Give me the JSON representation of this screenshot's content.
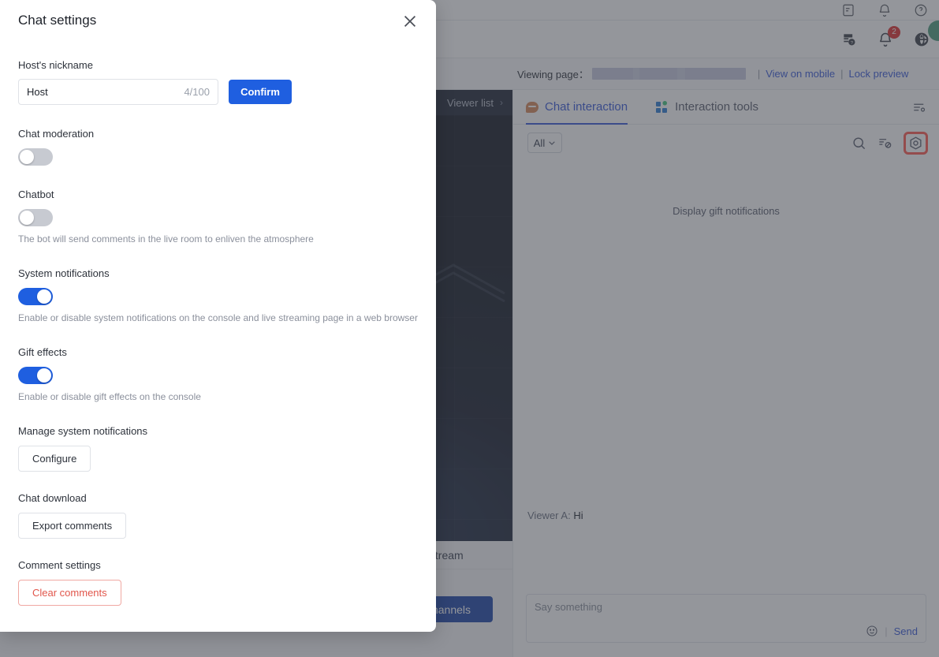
{
  "app": {
    "header": {
      "icons": [
        "doc-help-icon",
        "bell-icon",
        "globe-icon",
        "avatar"
      ],
      "notification_count": "2"
    },
    "viewing_bar": {
      "label": "Viewing page：",
      "url_redacted": "",
      "separator": "|",
      "view_on_mobile": "View on mobile",
      "lock_preview": "Lock preview"
    },
    "video": {
      "viewer_list_label": "Viewer list",
      "viewer_list_chevron": "›",
      "footer_label": "live stream",
      "cta_label": "channels"
    },
    "chat": {
      "tabs": [
        {
          "label": "Chat interaction",
          "icon": "chat-bubble-icon",
          "active": true
        },
        {
          "label": "Interaction tools",
          "icon": "grid-squares-icon",
          "active": false
        }
      ],
      "settings_icon": "list-settings-icon",
      "filter": {
        "selected": "All",
        "chevron": "⌄"
      },
      "filter_icons": [
        "search-icon",
        "mute-comments-icon",
        "gear-settings-icon"
      ],
      "gift_note": "Display gift notifications",
      "message": {
        "author": "Viewer A:",
        "text": "Hi"
      },
      "input": {
        "placeholder": "Say something",
        "emoji_icon": "emoji-smiley-icon",
        "separator": "|",
        "send_label": "Send"
      }
    }
  },
  "modal": {
    "title": "Chat settings",
    "close_icon": "close-icon",
    "nickname": {
      "label": "Host's nickname",
      "value": "Host",
      "placeholder": "Host's nickname",
      "counter": "4/100",
      "confirm_label": "Confirm"
    },
    "chat_moderation": {
      "label": "Chat moderation",
      "state": "off"
    },
    "chatbot": {
      "label": "Chatbot",
      "state": "off",
      "help": "The bot will send comments in the live room to enliven the atmosphere"
    },
    "system_notifications": {
      "label": "System notifications",
      "state": "on",
      "help": "Enable or disable system notifications on the console and live streaming page in a web browser"
    },
    "gift_effects": {
      "label": "Gift effects",
      "state": "on",
      "help": "Enable or disable gift effects on the console"
    },
    "manage_system_notifications": {
      "label": "Manage system notifications",
      "button": "Configure"
    },
    "chat_download": {
      "label": "Chat download",
      "button": "Export comments"
    },
    "comment_settings": {
      "label": "Comment settings",
      "button": "Clear comments"
    }
  },
  "colors": {
    "accent_blue": "#1f5fe0",
    "link_blue": "#3a5bd9",
    "danger_red": "#e1564b",
    "highlight_red": "#ff5b52",
    "toggle_off": "#c7cad1",
    "badge_red": "#e03131"
  }
}
